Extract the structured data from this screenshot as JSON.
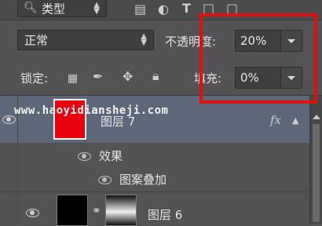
{
  "filter_bar": {
    "search_icon": "search-icon",
    "filter_type": "类型"
  },
  "blend_mode": {
    "value": "正常"
  },
  "opacity": {
    "label": "不透明度:",
    "value": "20%"
  },
  "lock": {
    "label": "锁定:"
  },
  "fill": {
    "label": "填充:",
    "value": "0%"
  },
  "layers": {
    "layer7": {
      "name": "图层 7",
      "fx": "fx",
      "thumb_color": "#e8000e"
    },
    "effects_label": "效果",
    "pattern_overlay": "图案叠加",
    "layer6": {
      "name": "图层 6"
    }
  },
  "watermark": "www.haoyidianshejі.com",
  "colors": {
    "highlight": "#e01010",
    "selected_row": "#5d6778"
  }
}
